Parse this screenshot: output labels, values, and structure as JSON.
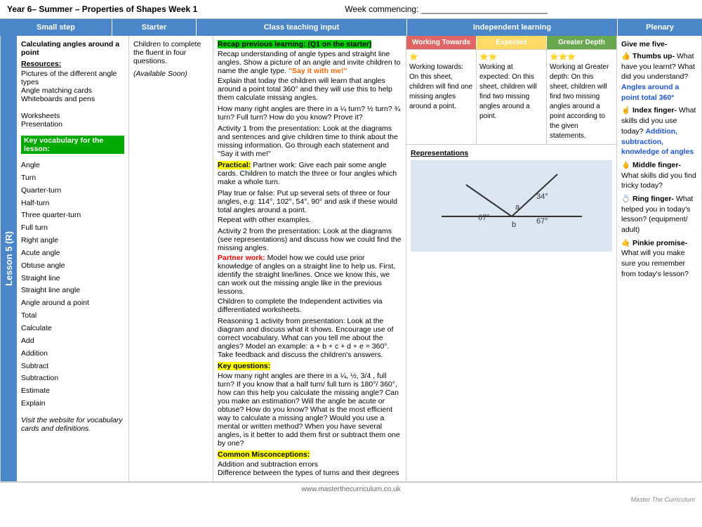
{
  "header": {
    "left": "Year 6– Summer – Properties of Shapes Week 1",
    "center": "Week commencing: ___________________________",
    "right": ""
  },
  "columns": {
    "small_step": "Small step",
    "starter": "Starter",
    "class_teaching": "Class teaching input",
    "independent": "Independent learning",
    "plenary": "Plenary"
  },
  "lesson_label": "Lesson 5 (R)",
  "small_step": {
    "title": "Calculating angles around a point",
    "resources_label": "Resources:",
    "resources": "Pictures of the different angle types\nAngle matching cards\nWhiteboards and pens\n\nWorksheets\nPresentation",
    "key_vocab_label": "Key vocabulary for the lesson:",
    "vocab_list": [
      "Angle",
      "Turn",
      "Quarter-turn",
      "Half-turn",
      "Three quarter-turn",
      "Full turn",
      "Right angle",
      "Acute angle",
      "Obtuse angle",
      "Straight line",
      "Straight line angle",
      "Angle around a point",
      "Total",
      "Calculate",
      "Add",
      "Addition",
      "Subtract",
      "Subtraction",
      "Estimate",
      "Explain"
    ],
    "website_note": "Visit the website for vocabulary cards and definitions."
  },
  "starter": {
    "text": "Children to complete the fluent in four questions.",
    "available": "(Available Soon)"
  },
  "class_teaching": {
    "recap_highlight": "Recap previous learning: (Q1 on the starter)",
    "recap_text": "Recap understanding of angle types and straight line angles. Show a picture of an angle and invite children to name the angle type.",
    "say_it_highlight": "\"Say it with me!\"",
    "explain_text": "Explain that today the children will learn that angles around a point total 360° and they will use this to help them calculate missing angles.",
    "how_many_right": "How many right angles are there in a ¼ turn? ½ turn? ¾ turn? Full turn? How do you know? Prove it?",
    "activity1_text": "Activity 1 from the presentation: Look at the diagrams and sentences and give children time to think about the missing information. Go through each statement and \"Say it with me!\"",
    "practical_highlight": "Practical:",
    "partner_work1": "Partner work: Give each pair some angle cards. Children to match the three or four angles which make a whole turn.",
    "play_true": "Play true or false: Put up several sets of three or four angles, e.g: 114°, 102°, 54°, 90° and ask if these would total angles around a point.",
    "repeat": "Repeat with other examples.",
    "activity2_text": "Activity 2 from the presentation: Look at the diagrams (see representations) and discuss how we could find the missing angles.",
    "partner_work2_highlight": "Partner work:",
    "partner_work2_text": "Model how we could use prior knowledge of angles on a straight line to help us. First, identify the straight line/lines. Once we know this, we can work out the missing angle like in the previous lessons.",
    "children_complete": "Children to complete the Independent activities  via differentiated worksheets.",
    "reasoning_text": "Reasoning 1 activity from presentation: Look at the diagram and discuss what it shows. Encourage use of correct vocabulary. What can you tell me about the angles? Model an example: a + b + c + d + e = 360°.  Take feedback and discuss the children's answers.",
    "key_questions_highlight": "Key questions:",
    "key_questions_text": "How many right angles are there in a ¼, ½, 3/4 , full turn? If you know that a half turn/ full turn is 180°/ 360°, how can this help you calculate the missing angle? Can you make an estimation? Will the angle be acute or obtuse? How do you know?  What is the most efficient way to calculate a missing angle? Would you use a mental or written method? When you have several angles, is it better to add them first or subtract them one by one?",
    "misconceptions_highlight": "Common Misconceptions:",
    "misconceptions_text": "Addition and subtraction errors\nDifference between the types of turns and their degrees"
  },
  "independent": {
    "headers": [
      "Working Towards",
      "Expected",
      "Greater Depth"
    ],
    "working_towards": {
      "stars": 1,
      "text": "Working towards: On this sheet, children will find one missing angles around a point."
    },
    "expected": {
      "stars": 2,
      "text": "Working at expected: On this sheet, children will find two missing angles around a point."
    },
    "greater_depth": {
      "stars": 3,
      "text": "Working at Greater depth: On this sheet, children will find two missing angles around a point according to the given statements."
    },
    "representations_label": "Representations",
    "diagram": {
      "angle_a": "a",
      "angle_b": "b",
      "angle_34": "34°",
      "angle_67_left": "67°",
      "angle_67_right": "67°"
    }
  },
  "plenary": {
    "intro": "Give me five-",
    "items": [
      {
        "icon": "👍",
        "finger": "Thumbs up-",
        "text": "What have you learnt? What did you understand?",
        "highlight": "Angles around a point total 360°"
      },
      {
        "icon": "☝️",
        "finger": "Index finger-",
        "text": "What skills did you use today?",
        "highlight": "Addition, subtraction, knowledge of angles"
      },
      {
        "icon": "🖕",
        "finger": "Middle finger-",
        "text": "What skills did you find tricky today?"
      },
      {
        "icon": "💍",
        "finger": "Ring finger-",
        "text": "What helped you in today's lesson? (equipment/ adult)"
      },
      {
        "icon": "🤙",
        "finger": "Pinkie promise-",
        "text": "What will you make sure you remember from today's lesson?"
      }
    ]
  },
  "footer": {
    "url": "www.masterthecurriculum.co.uk",
    "watermark": "Master The Curriculum"
  }
}
